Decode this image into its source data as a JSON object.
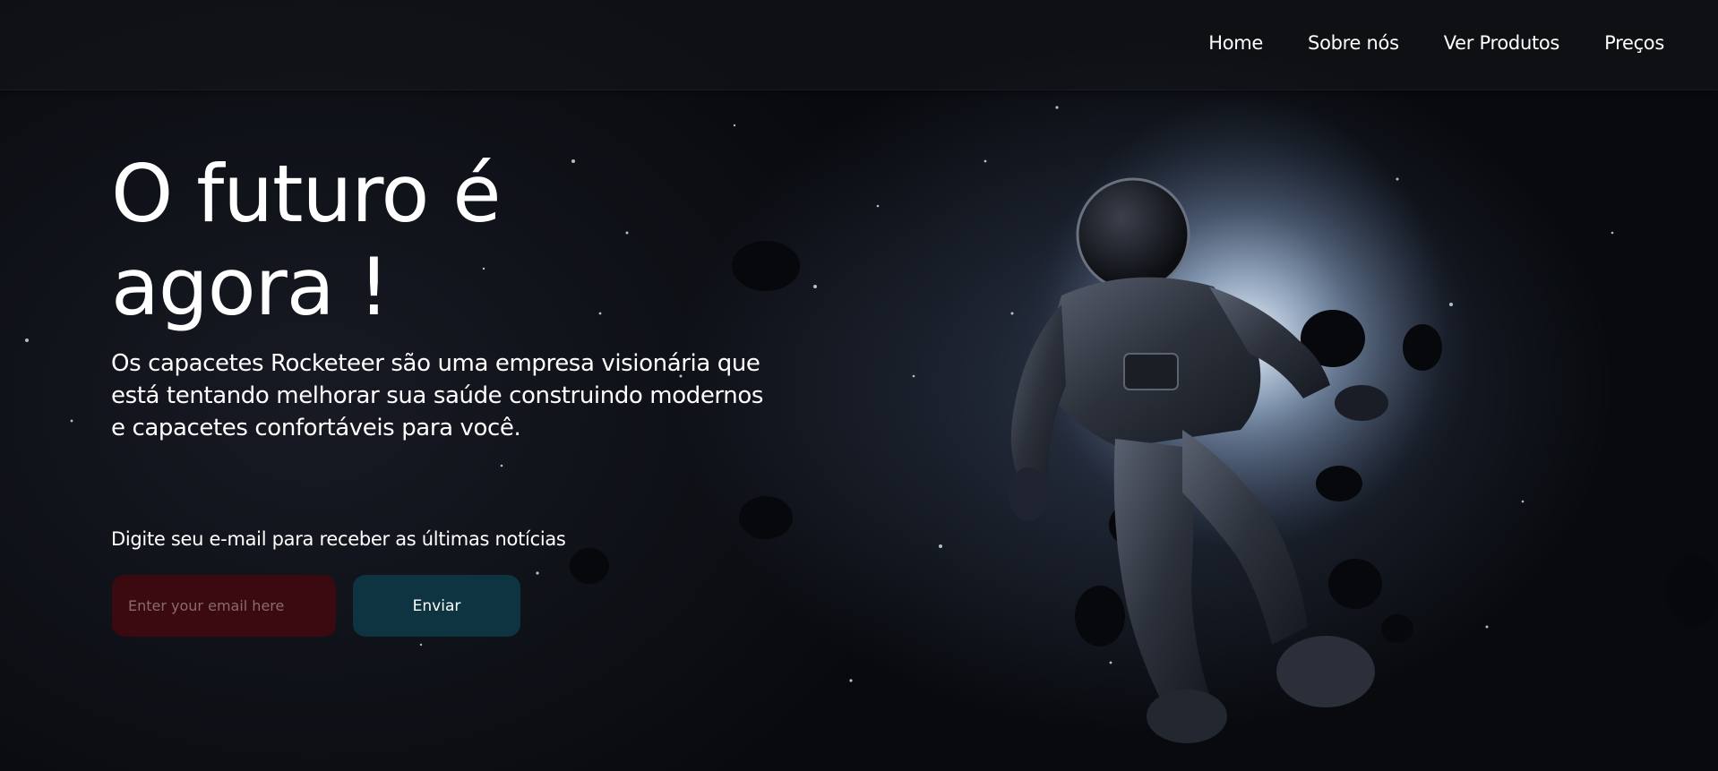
{
  "nav": {
    "items": [
      {
        "label": "Home"
      },
      {
        "label": "Sobre nós"
      },
      {
        "label": "Ver Produtos"
      },
      {
        "label": "Preços"
      }
    ]
  },
  "hero": {
    "title": "O futuro é agora !",
    "description": "Os capacetes Rocketeer são uma empresa visionária que está tentando melhorar sua saúde construindo modernos e capacetes confortáveis para você."
  },
  "newsletter": {
    "label": "Digite seu e-mail para receber as últimas notícias",
    "email_placeholder": "Enter your email here",
    "email_value": "",
    "submit_label": "Enviar"
  },
  "colors": {
    "input_bg": "#3a0a10",
    "button_bg": "#0d3440",
    "text": "#ffffff"
  },
  "background_image": "astronaut-floating-in-space"
}
